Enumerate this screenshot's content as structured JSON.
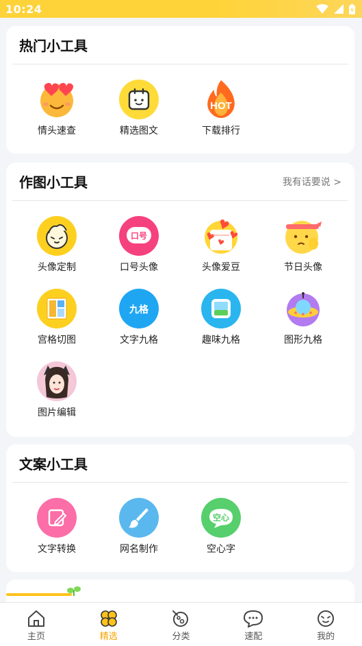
{
  "status": {
    "time": "10:24"
  },
  "section1": {
    "title": "热门小工具",
    "items": [
      {
        "label": "情头速查",
        "icon": "love-eyes-emoji-icon"
      },
      {
        "label": "精选图文",
        "icon": "calendar-face-icon"
      },
      {
        "label": "下载排行",
        "icon": "hot-fire-icon",
        "icon_text": "HOT"
      }
    ]
  },
  "section2": {
    "title": "作图小工具",
    "link": "我有话要说 >",
    "items": [
      {
        "label": "头像定制",
        "icon": "cartoon-face-icon"
      },
      {
        "label": "口号头像",
        "icon": "slogan-icon",
        "icon_text": "口号"
      },
      {
        "label": "头像爱豆",
        "icon": "hearts-calendar-icon"
      },
      {
        "label": "节日头像",
        "icon": "headband-emoji-icon"
      },
      {
        "label": "宫格切图",
        "icon": "grid-cut-icon"
      },
      {
        "label": "文字九格",
        "icon": "text-nine-grid-icon",
        "icon_text": "九格"
      },
      {
        "label": "趣味九格",
        "icon": "fun-nine-grid-icon"
      },
      {
        "label": "图形九格",
        "icon": "ufo-icon"
      },
      {
        "label": "图片编辑",
        "icon": "photo-edit-avatar-icon"
      }
    ]
  },
  "section3": {
    "title": "文案小工具",
    "items": [
      {
        "label": "文字转换",
        "icon": "text-convert-icon"
      },
      {
        "label": "网名制作",
        "icon": "brush-icon"
      },
      {
        "label": "空心字",
        "icon": "hollow-text-icon",
        "icon_text": "空心"
      }
    ]
  },
  "tabbar": {
    "tabs": [
      {
        "label": "主页",
        "icon": "home-icon"
      },
      {
        "label": "精选",
        "icon": "clover-icon",
        "active": true
      },
      {
        "label": "分类",
        "icon": "planet-icon"
      },
      {
        "label": "速配",
        "icon": "chat-bubble-icon"
      },
      {
        "label": "我的",
        "icon": "smile-face-icon"
      }
    ]
  },
  "colors": {
    "accent": "#f5a500",
    "statusbar": "#fed33a"
  }
}
